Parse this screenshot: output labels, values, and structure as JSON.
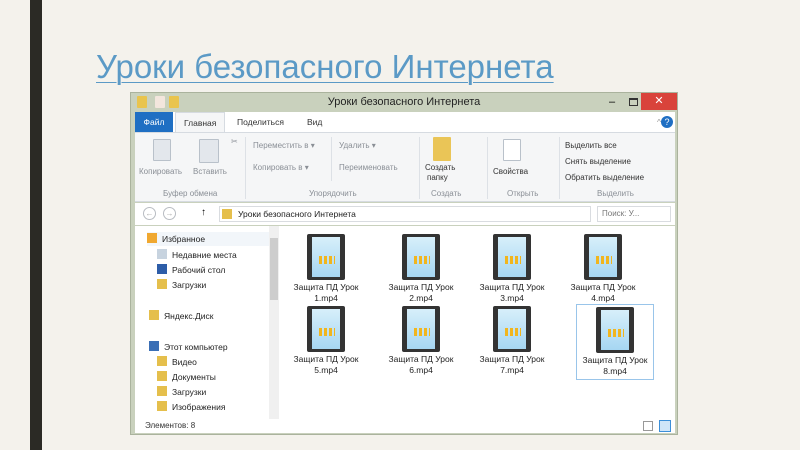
{
  "slide_title": "Уроки безопасного Интернета",
  "window": {
    "title": "Уроки безопасного Интернета",
    "close": "✕",
    "minimize": "–"
  },
  "tabs": [
    "Файл",
    "Главная",
    "Поделиться",
    "Вид"
  ],
  "help": "?",
  "ribbon": {
    "copy": "Копировать",
    "paste": "Вставить",
    "group_clipboard": "Буфер обмена",
    "move_to": "Переместить в ▾",
    "copy_to": "Копировать в ▾",
    "delete": "Удалить ▾",
    "rename": "Переименовать",
    "group_organize": "Упорядочить",
    "new_folder_1": "Создать",
    "new_folder_2": "папку",
    "group_new": "Создать",
    "properties": "Свойства",
    "group_open": "Открыть",
    "select_all": "Выделить все",
    "select_none": "Снять выделение",
    "invert": "Обратить выделение",
    "group_select": "Выделить"
  },
  "address": {
    "path": "Уроки безопасного Интернета",
    "search_placeholder": "Поиск: У..."
  },
  "sidebar": {
    "favorites": "Избранное",
    "items": [
      "Недавние места",
      "Рабочий стол",
      "Загрузки"
    ],
    "yandex": "Яндекс.Диск",
    "computer": "Этот компьютер",
    "computer_items": [
      "Видео",
      "Документы",
      "Загрузки",
      "Изображения"
    ]
  },
  "files": [
    {
      "line1": "Защита ПД Урок",
      "line2": "1.mp4"
    },
    {
      "line1": "Защита ПД Урок",
      "line2": "2.mp4"
    },
    {
      "line1": "Защита ПД Урок",
      "line2": "3.mp4"
    },
    {
      "line1": "Защита ПД Урок",
      "line2": "4.mp4"
    },
    {
      "line1": "Защита ПД Урок",
      "line2": "5.mp4"
    },
    {
      "line1": "Защита ПД Урок",
      "line2": "6.mp4"
    },
    {
      "line1": "Защита ПД Урок",
      "line2": "7.mp4"
    },
    {
      "line1": "Защита ПД Урок",
      "line2": "8.mp4"
    }
  ],
  "status": "Элементов: 8"
}
